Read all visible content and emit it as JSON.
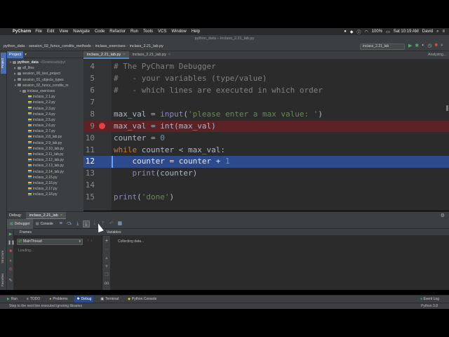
{
  "menubar": {
    "app": "PyCharm",
    "items": [
      "File",
      "Edit",
      "View",
      "Navigate",
      "Code",
      "Refactor",
      "Run",
      "Tools",
      "VCS",
      "Window",
      "Help"
    ],
    "battery": "100%",
    "clock": "Sat 10:19 AM",
    "user": "David"
  },
  "window_title": "python_data – inclass_2.21_lab.py",
  "breadcrumb": [
    "python_data",
    "session_02_funcs_condits_methods",
    "inclass_exercises",
    "inclass_2.21_lab.py"
  ],
  "run_config": "inclass_2.21_lab",
  "project_panel": {
    "title": "Project",
    "root": "python_data",
    "root_path": "~/Downloads/pyt",
    "folders": [
      "all_files",
      "session_00_test_project",
      "session_01_objects_types",
      "session_02_funcs_condits_m",
      "inclass_exercises"
    ],
    "files": [
      "inclass_2.1.py",
      "inclass_2.2.py",
      "inclass_2.3.py",
      "inclass_2.4.py",
      "inclass_2.5.py",
      "inclass_2.6.py",
      "inclass_2.7.py",
      "inclass_2.8_lab.py",
      "inclass_2.9_lab.py",
      "inclass_2.10_lab.py",
      "inclass_2.11_lab.py",
      "inclass_2.12_lab.py",
      "inclass_2.13_lab.py",
      "inclass_2.14_lab.py",
      "inclass_2.15.py",
      "inclass_2.16.py",
      "inclass_2.17.py",
      "inclass_2.18.py"
    ]
  },
  "editor": {
    "tabs": [
      "inclass_2.21_lab.py",
      "inclass_2.21_lab.py"
    ],
    "status": "Analyzing...",
    "line_numbers": [
      "4",
      "5",
      "6",
      "7",
      "8",
      "9",
      "10",
      "11",
      "12",
      "13",
      "14",
      "15"
    ],
    "code": {
      "l4": "# The PyCharm Debugger",
      "l5": "#   - your variables (type/value)",
      "l6": "#   - which lines are executed in which order",
      "l8_a": "max_val",
      "l8_b": " = ",
      "l8_c": "input",
      "l8_d": "(",
      "l8_e": "'please enter a max value: '",
      "l8_f": ")",
      "l9": "max_val = int(max_val)",
      "l10_a": "counter = ",
      "l10_b": "0",
      "l11_a": "while",
      "l11_b": " counter < max_val:",
      "l12_a": "    counter = counter + ",
      "l12_b": "1",
      "l13_a": "    ",
      "l13_b": "print",
      "l13_c": "(counter)",
      "l15_a": "print",
      "l15_b": "(",
      "l15_c": "'done'",
      "l15_d": ")"
    }
  },
  "debug": {
    "label": "Debug:",
    "session_tab": "inclass_2.21_lab",
    "tabs": [
      "Debugger",
      "Console"
    ],
    "frames_label": "Frames",
    "variables_label": "Variables",
    "thread": "MainThread",
    "frames_status": "Loading...",
    "variables_status": "Collecting data..."
  },
  "tool_windows": [
    "Run",
    "TODO",
    "Problems",
    "Debug",
    "Terminal",
    "Python Console"
  ],
  "event_log": "Event Log",
  "status": {
    "message": "Step to the next line executed ignoring libraries",
    "interpreter": "Python 3.8"
  },
  "side_tabs": [
    "Project",
    "Structure",
    "Favorites"
  ],
  "colors": {
    "breakpoint": "#e44141",
    "breakpoint_line": "#5c2226",
    "execution_line": "#2d4b8c",
    "accent": "#4a88c7"
  }
}
